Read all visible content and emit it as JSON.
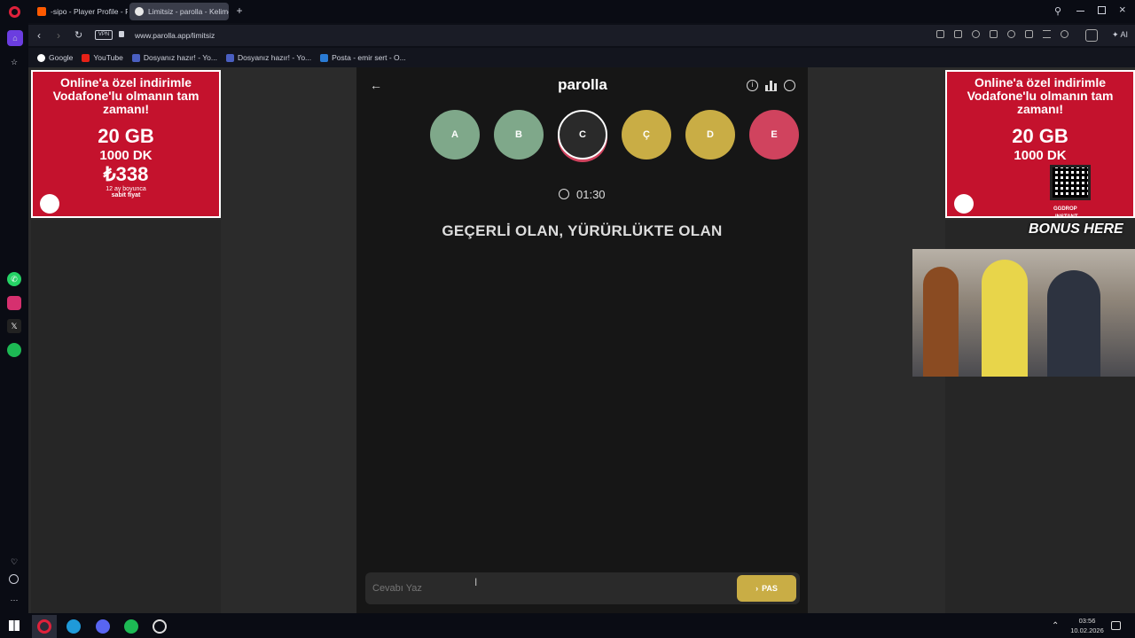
{
  "browser": {
    "tabs": [
      {
        "label": "-sipo - Player Profile - FAC"
      },
      {
        "label": "Limitsiz - parolla - Kelime"
      }
    ],
    "url": "www.parolla.app/limitsiz",
    "vpn_label": "VPN",
    "ai_label": "AI",
    "bookmarks": [
      {
        "label": "Google"
      },
      {
        "label": "YouTube"
      },
      {
        "label": "Dosyanız hazır! - Yo..."
      },
      {
        "label": "Dosyanız hazır! - Yo..."
      },
      {
        "label": "Posta - emir sert - O..."
      }
    ]
  },
  "app": {
    "title": "parolla",
    "letters": [
      {
        "label": "A",
        "color": "#7fa88a"
      },
      {
        "label": "B",
        "color": "#7fa88a"
      },
      {
        "label": "C",
        "color": "#2a2a2a"
      },
      {
        "label": "Ç",
        "color": "#c9ad45"
      },
      {
        "label": "D",
        "color": "#c9ad45"
      },
      {
        "label": "E",
        "color": "#d0435e"
      }
    ],
    "timer": "01:30",
    "question": "GEÇERLİ OLAN, YÜRÜRLÜKTE OLAN",
    "answer_placeholder": "Cevabı Yaz",
    "pass_label": "PAS"
  },
  "ads": {
    "headline": "Online'a özel indirimle Vodafone'lu olmanın tam zamanı!",
    "gb": "20 GB",
    "minutes": "1000 DK",
    "price": "₺338",
    "duration": "12 ay boyunca",
    "fixed": "sabit fiyat",
    "overlay_brand": "GGDROP",
    "overlay_sub": "INSTANT",
    "overlay_text": "BONUS HERE"
  },
  "taskbar": {
    "time": "03:56",
    "date": "10.02.2026"
  }
}
